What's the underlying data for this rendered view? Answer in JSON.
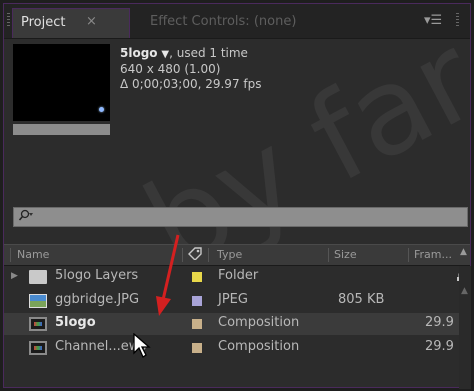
{
  "tabs": {
    "project": {
      "label": "Project",
      "close": "×"
    },
    "effects": {
      "label": "Effect Controls: (none)"
    },
    "menu": "▾☰"
  },
  "preview": {
    "name": "5logo",
    "name_arrow": "▼",
    "used": ", used 1 time",
    "resolution": "640 x 480 (1.00)",
    "duration": "Δ 0;00;03;00, 29.97 fps"
  },
  "search": {
    "placeholder": "",
    "icon": "search-icon"
  },
  "columns": {
    "name": "Name",
    "label": "label-tag-icon",
    "type": "Type",
    "size": "Size",
    "frame_rate": "Fram..."
  },
  "rows": [
    {
      "name": "5logo Layers",
      "icon": "folder-icon",
      "label_color": "#e8d84a",
      "type": "Folder",
      "size": "",
      "frame_rate": "",
      "expandable": true,
      "bold": false,
      "selected": false
    },
    {
      "name": "ggbridge.JPG",
      "icon": "image-file-icon",
      "label_color": "#a9a4d8",
      "type": "JPEG",
      "size": "805 KB",
      "frame_rate": "",
      "expandable": false,
      "bold": false,
      "selected": false
    },
    {
      "name": "5logo",
      "icon": "composition-icon",
      "label_color": "#c8b08a",
      "type": "Composition",
      "size": "",
      "frame_rate": "29.9",
      "expandable": false,
      "bold": true,
      "selected": true
    },
    {
      "name": "Channel...ews",
      "icon": "composition-icon",
      "label_color": "#c8b08a",
      "type": "Composition",
      "size": "",
      "frame_rate": "29.9",
      "expandable": false,
      "bold": false,
      "selected": false
    }
  ],
  "watermark": "by far",
  "colors": {
    "annotation_arrow": "#d42020",
    "panel_border": "#4a2a5c"
  }
}
